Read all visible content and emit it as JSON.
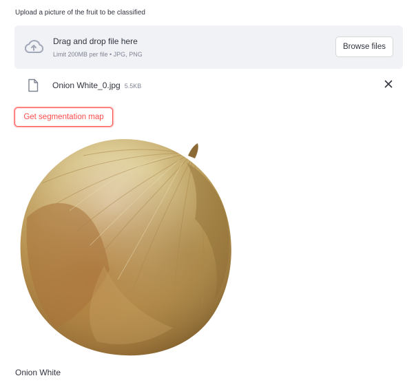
{
  "uploader": {
    "label": "Upload a picture of the fruit to be classified",
    "dropzone_title": "Drag and drop file here",
    "dropzone_limit": "Limit 200MB per file • JPG, PNG",
    "browse_label": "Browse files",
    "icon": "cloud-upload-icon"
  },
  "file": {
    "name": "Onion White_0.jpg",
    "size": "5.5KB",
    "icon": "file-icon",
    "remove_icon": "close-icon"
  },
  "actions": {
    "segmentation_label": "Get segmentation map"
  },
  "image": {
    "subject": "onion"
  },
  "result": {
    "label": "Onion White"
  },
  "colors": {
    "accent": "#ff4b4b",
    "dropzone_bg": "#f0f2f6",
    "text": "#31333f",
    "muted": "#808495"
  }
}
